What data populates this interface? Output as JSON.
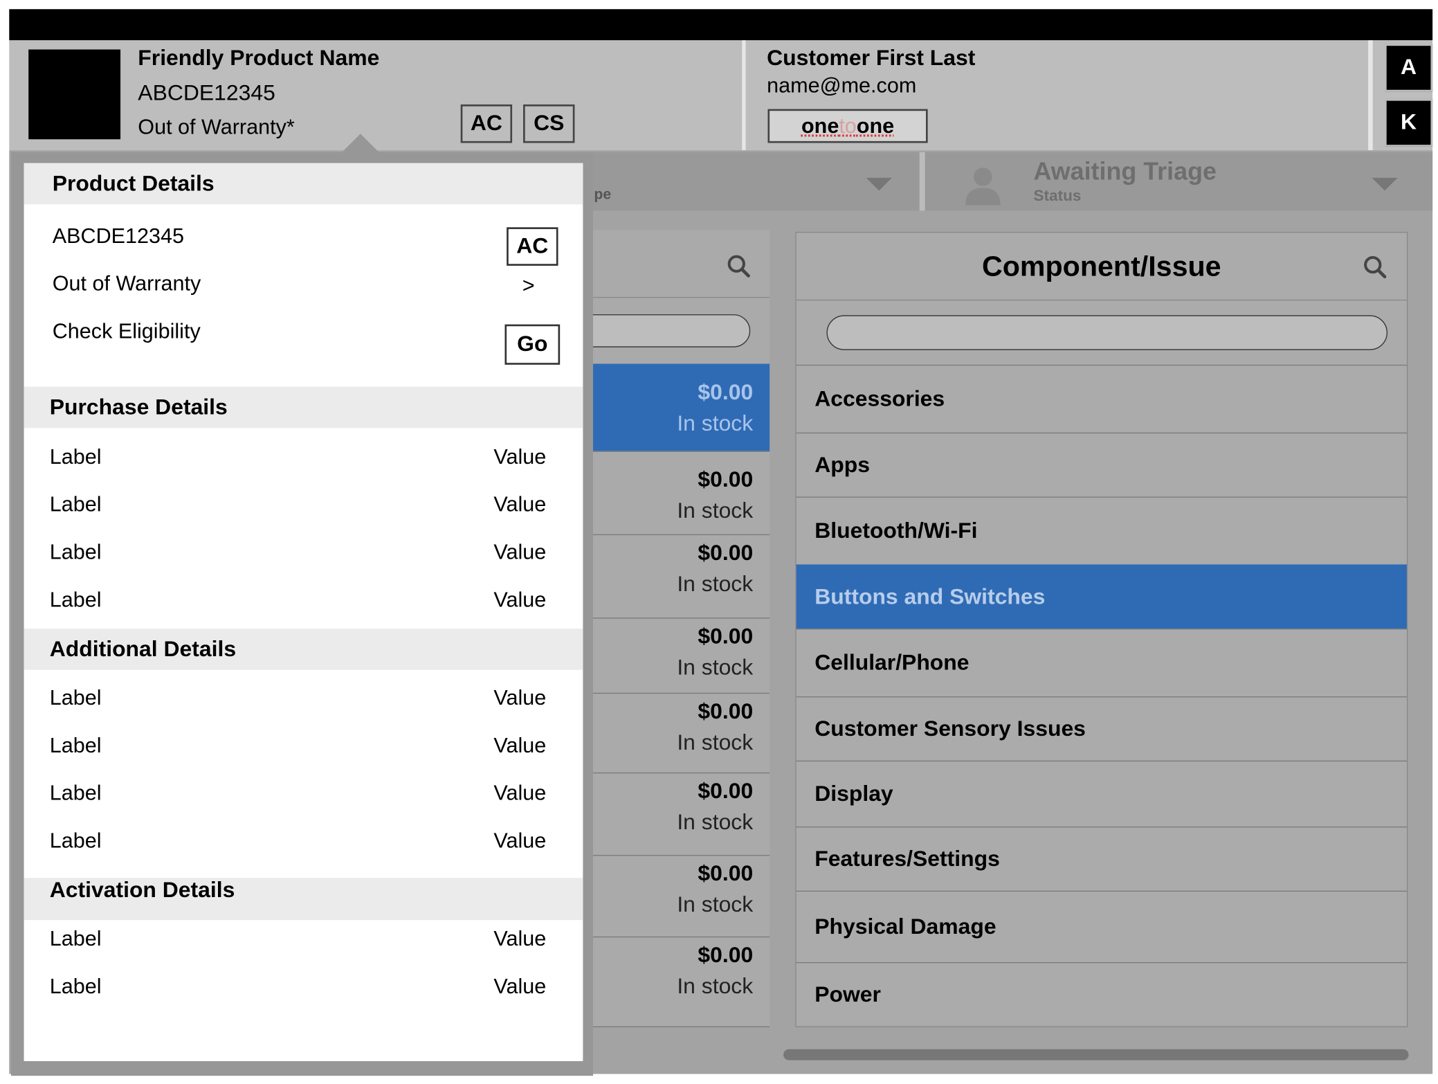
{
  "header": {
    "product_name": "Friendly Product Name",
    "serial": "ABCDE12345",
    "warranty": "Out of Warranty*",
    "btn_ac": "AC",
    "btn_cs": "CS",
    "customer_name": "Customer First Last",
    "customer_email": "name@me.com",
    "onetoone_one": "one",
    "onetoone_to": "to",
    "onetoone_one2": "one",
    "btn_a": "A",
    "btn_k": "K"
  },
  "filterbar": {
    "type_label_fragment": "pe",
    "status_value": "Awaiting Triage",
    "status_label": "Status"
  },
  "price_list": [
    {
      "amount": "$0.00",
      "stock": "In stock",
      "selected": true
    },
    {
      "amount": "$0.00",
      "stock": "In stock"
    },
    {
      "amount": "$0.00",
      "stock": "In stock"
    },
    {
      "amount": "$0.00",
      "stock": "In stock"
    },
    {
      "amount": "$0.00",
      "stock": "In stock"
    },
    {
      "amount": "$0.00",
      "stock": "In stock"
    },
    {
      "amount": "$0.00",
      "stock": "In stock"
    },
    {
      "amount": "$0.00",
      "stock": "In stock"
    }
  ],
  "component": {
    "title": "Component/Issue",
    "search_placeholder": "",
    "items": [
      {
        "label": "Accessories"
      },
      {
        "label": "Apps"
      },
      {
        "label": "Bluetooth/Wi-Fi"
      },
      {
        "label": "Buttons and Switches",
        "selected": true
      },
      {
        "label": "Cellular/Phone"
      },
      {
        "label": "Customer Sensory Issues"
      },
      {
        "label": "Display"
      },
      {
        "label": "Features/Settings"
      },
      {
        "label": "Physical Damage"
      },
      {
        "label": "Power"
      }
    ]
  },
  "popover": {
    "product_details_title": "Product Details",
    "serial": "ABCDE12345",
    "warranty": "Out of Warranty",
    "check_eligibility": "Check Eligibility",
    "btn_ac": "AC",
    "chevron": ">",
    "btn_go": "Go",
    "purchase_title": "Purchase Details",
    "purchase_rows": [
      {
        "label": "Label",
        "value": "Value"
      },
      {
        "label": "Label",
        "value": "Value"
      },
      {
        "label": "Label",
        "value": "Value"
      },
      {
        "label": "Label",
        "value": "Value"
      }
    ],
    "additional_title": "Additional Details",
    "additional_rows": [
      {
        "label": "Label",
        "value": "Value"
      },
      {
        "label": "Label",
        "value": "Value"
      },
      {
        "label": "Label",
        "value": "Value"
      },
      {
        "label": "Label",
        "value": "Value"
      }
    ],
    "activation_title": "Activation Details",
    "activation_rows": [
      {
        "label": "Label",
        "value": "Value"
      },
      {
        "label": "Label",
        "value": "Value"
      }
    ]
  },
  "colors": {
    "selection_blue": "#2f6bb5",
    "header_gray": "#bdbdbd",
    "overlay_gray": "#979797"
  }
}
